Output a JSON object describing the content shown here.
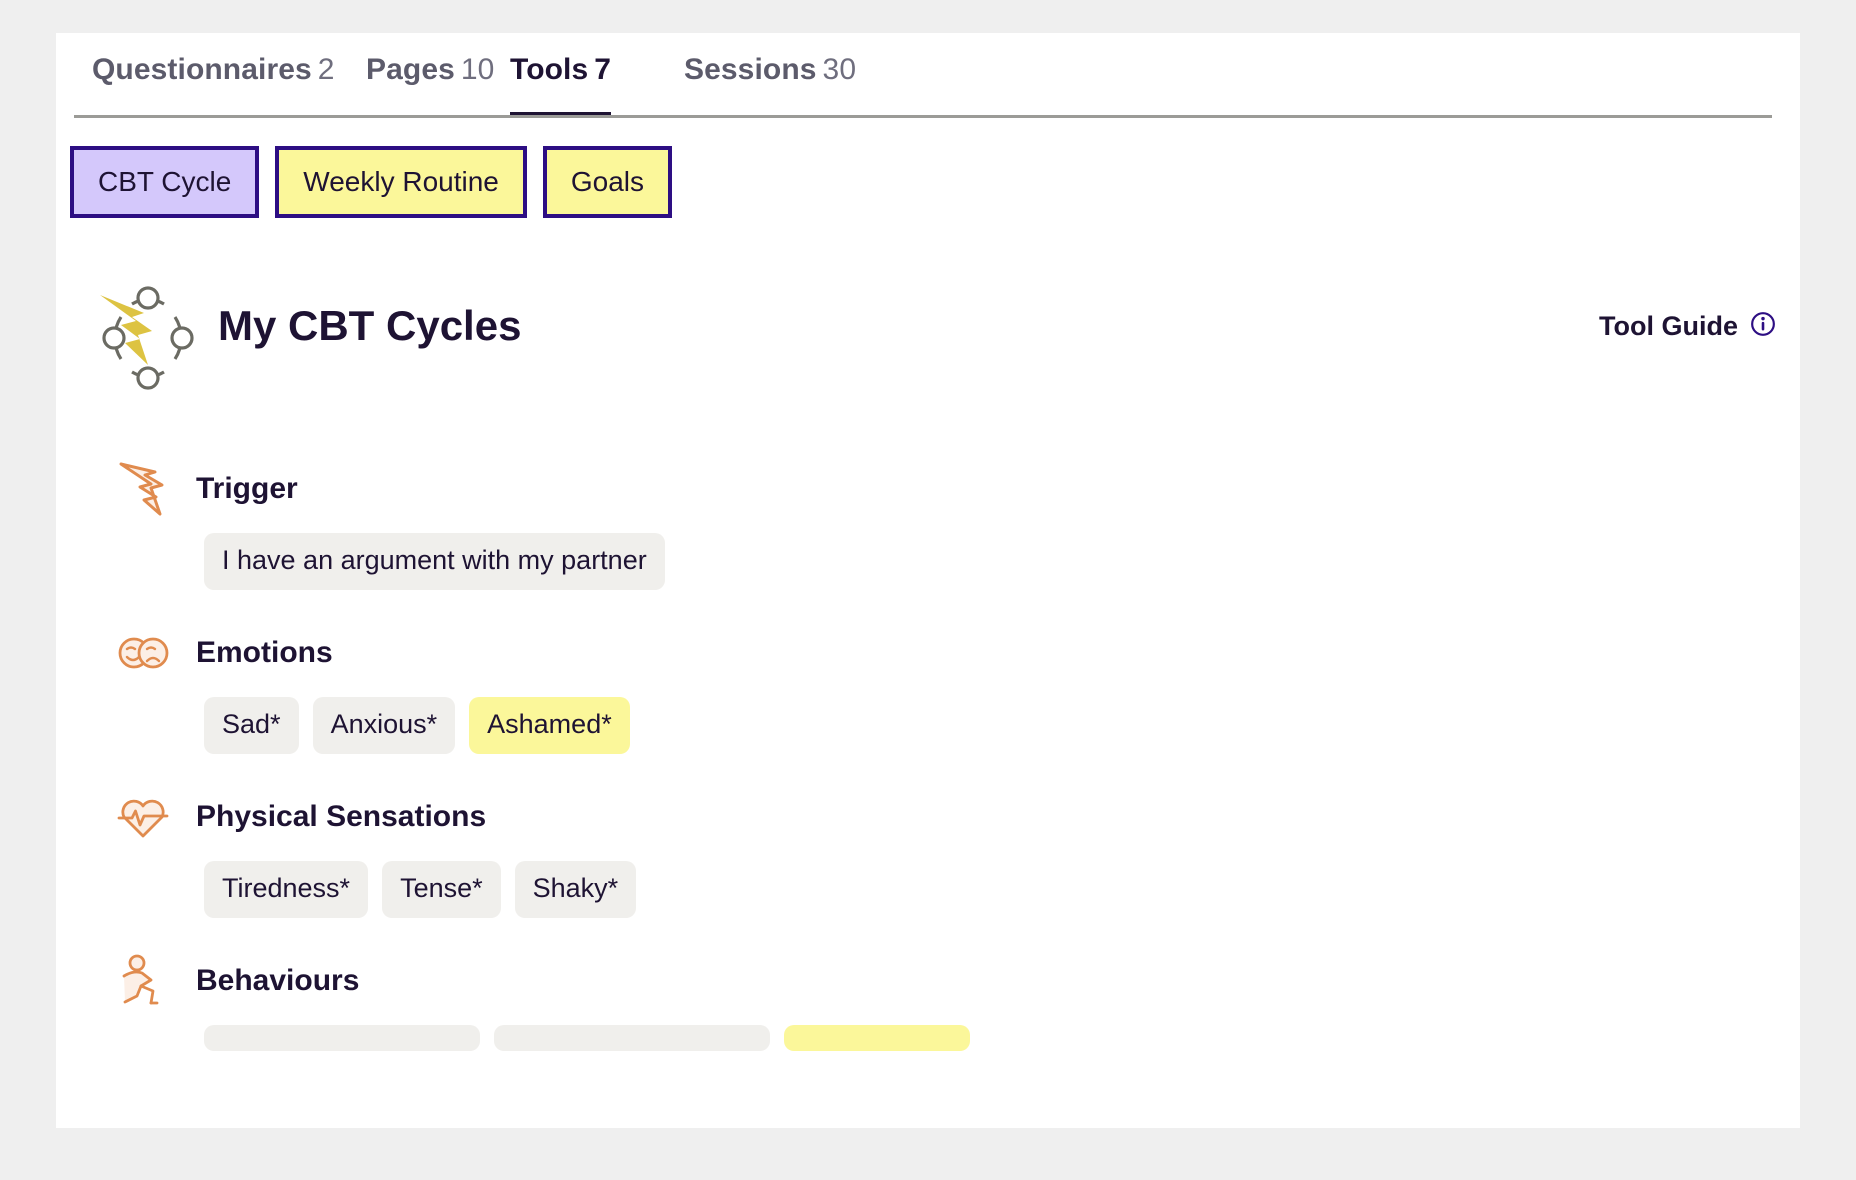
{
  "theme": {
    "page_background": "#efefef",
    "card_background": "#ffffff",
    "accent_purple": "#2d0e83",
    "chip_selected_fill": "#d4c8fb",
    "chip_fill": "#fbf79a",
    "pill_fill": "#f0efec",
    "pill_highlight_fill": "#fbf79a",
    "heading_color": "#1e1333",
    "icon_orange": "#e08b4e",
    "icon_yellow": "#ddc342",
    "tab_inactive_color": "#5c5b6b"
  },
  "tabs": [
    {
      "label": "Questionnaires",
      "count": "2",
      "active": false,
      "name": "tab-questionnaires"
    },
    {
      "label": "Pages",
      "count": "10",
      "active": false,
      "name": "tab-pages"
    },
    {
      "label": "Tools",
      "count": "7",
      "active": true,
      "name": "tab-tools"
    },
    {
      "label": "Sessions",
      "count": "30",
      "active": false,
      "name": "tab-sessions"
    }
  ],
  "tool_chips": [
    {
      "label": "CBT Cycle",
      "selected": true
    },
    {
      "label": "Weekly Routine",
      "selected": false
    },
    {
      "label": "Goals",
      "selected": false
    }
  ],
  "tool_header": {
    "icon": "cbt-cycle-icon",
    "title": "My CBT Cycles",
    "guide_label": "Tool Guide",
    "guide_icon": "info-circle-icon"
  },
  "sections": [
    {
      "id": "trigger",
      "icon": "lightning-bolt-icon",
      "title": "Trigger",
      "items": [
        {
          "text": "I have an argument with my partner",
          "highlight": false
        }
      ]
    },
    {
      "id": "emotions",
      "icon": "two-faces-icon",
      "title": "Emotions",
      "items": [
        {
          "text": "Sad*",
          "highlight": false
        },
        {
          "text": "Anxious*",
          "highlight": false
        },
        {
          "text": "Ashamed*",
          "highlight": true
        }
      ]
    },
    {
      "id": "physical-sensations",
      "icon": "heart-pulse-icon",
      "title": "Physical Sensations",
      "items": [
        {
          "text": "Tiredness*",
          "highlight": false
        },
        {
          "text": "Tense*",
          "highlight": false
        },
        {
          "text": "Shaky*",
          "highlight": false
        }
      ]
    },
    {
      "id": "behaviours",
      "icon": "running-person-icon",
      "title": "Behaviours",
      "items": [
        {
          "text": "",
          "highlight": false
        },
        {
          "text": "",
          "highlight": false
        },
        {
          "text": "",
          "highlight": true
        }
      ]
    }
  ]
}
